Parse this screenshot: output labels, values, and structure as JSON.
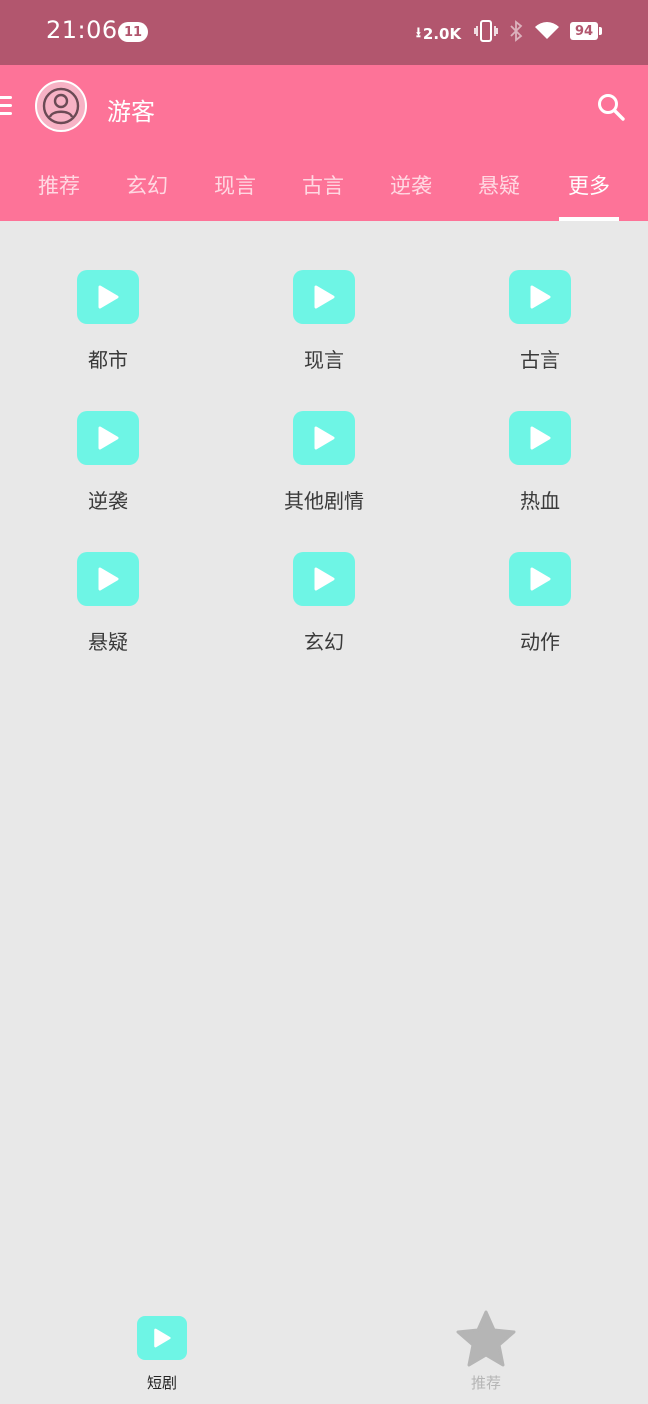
{
  "status_bar": {
    "time": "21:06",
    "notification_count": "11",
    "net_speed": "2.0K",
    "battery": "94",
    "icons": [
      "download-arrow-icon",
      "vibrate-icon",
      "bluetooth-icon",
      "wifi-icon",
      "battery-icon"
    ]
  },
  "header": {
    "username": "游客",
    "icons": [
      "menu-icon",
      "avatar-icon",
      "search-icon"
    ],
    "background": "#fd7398"
  },
  "tabs": {
    "items": [
      "推荐",
      "玄幻",
      "现言",
      "古言",
      "逆袭",
      "悬疑",
      "更多"
    ],
    "active": "更多"
  },
  "categories": {
    "items": [
      "都市",
      "现言",
      "古言",
      "逆袭",
      "其他剧情",
      "热血",
      "悬疑",
      "玄幻",
      "动作"
    ],
    "icon": "play-icon",
    "icon_color": "#6ef5e5"
  },
  "bottom_nav": {
    "items": [
      {
        "label": "短剧",
        "icon": "play-icon",
        "active": true
      },
      {
        "label": "推荐",
        "icon": "star-icon",
        "active": false
      }
    ]
  },
  "colors": {
    "status_bar": "#b2566e",
    "accent": "#fd7398",
    "teal": "#6ef5e5",
    "background": "#e8e8e8"
  }
}
